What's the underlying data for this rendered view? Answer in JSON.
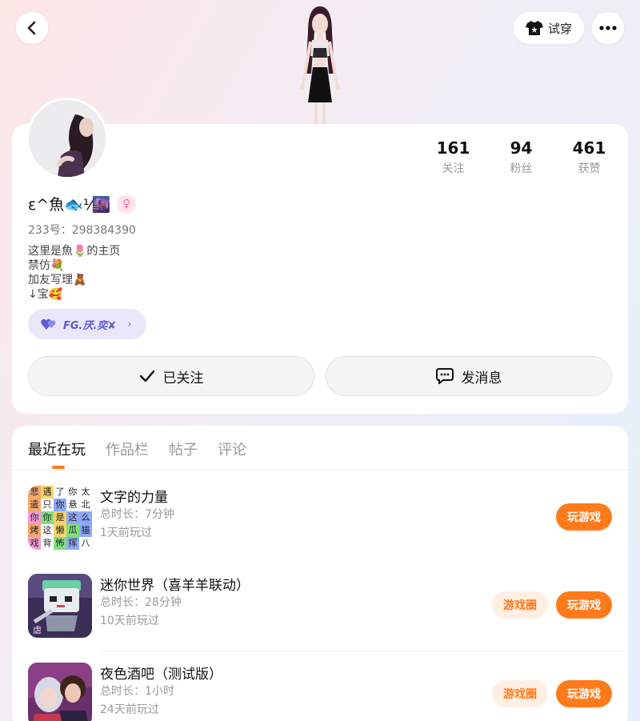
{
  "header": {
    "tryon_label": "试穿"
  },
  "profile": {
    "nickname": "ε^魚🐟⅟🌆",
    "gender_symbol": "♀",
    "uid": "233号：298384390",
    "bio_lines": [
      "这里是魚🌷的主页",
      "禁仿💐",
      "加友写理🧸",
      "↓宝🥰"
    ],
    "stats": [
      {
        "value": "161",
        "label": "关注"
      },
      {
        "value": "94",
        "label": "粉丝"
      },
      {
        "value": "461",
        "label": "获赞"
      }
    ],
    "group_label": "FG.厌.奕✘",
    "follow_label": "已关注",
    "message_label": "发消息"
  },
  "tabs": [
    "最近在玩",
    "作品栏",
    "帖子",
    "评论"
  ],
  "games": [
    {
      "title": "文字的力量",
      "duration": "总时长：7分钟",
      "last_played": "1天前玩过",
      "play_label": "玩游戏",
      "icon": "character-grid-icon",
      "grid": [
        "悲",
        "遇",
        "了",
        "你",
        "太",
        "遣",
        "只",
        "你",
        "悬",
        "北",
        "你",
        "你",
        "是",
        "这",
        "么",
        "烤",
        "这",
        "懒",
        "瓜",
        "猫",
        "戏",
        "背",
        "怖",
        "挥",
        "八"
      ],
      "grid_colors": [
        "#f7a66b",
        "#f6d36b",
        "#fff",
        "#fff",
        "#fff",
        "#f7a66b",
        "#fff",
        "#8fa8f8",
        "#fff",
        "#fff",
        "#f39ad2",
        "#7fe07f",
        "#f6d36b",
        "#8fa8f8",
        "#8fa8f8",
        "#f7a66b",
        "#fff",
        "#f6d36b",
        "#7fe07f",
        "#8fa8f8",
        "#f39ad2",
        "#fff",
        "#7fe07f",
        "#8fa8f8",
        "#fff"
      ]
    },
    {
      "title": "迷你世界（喜羊羊联动）",
      "duration": "总时长：28分钟",
      "last_played": "10天前玩过",
      "circle_label": "游戏圈",
      "play_label": "玩游戏",
      "icon": "mini-world-icon"
    },
    {
      "title": "夜色酒吧（测试版）",
      "duration": "总时长：1小时",
      "last_played": "24天前玩过",
      "circle_label": "游戏圈",
      "play_label": "玩游戏",
      "icon": "night-bar-icon"
    }
  ],
  "colors": {
    "accent": "#ff7a1a",
    "accent_soft": "#ffefe3",
    "pill_bg": "#ebe7fb",
    "pill_text": "#5d5bd6"
  }
}
